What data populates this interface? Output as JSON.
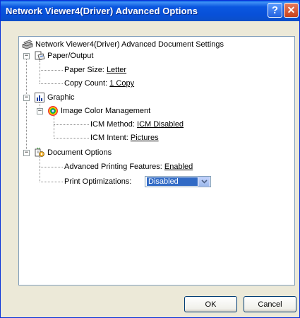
{
  "window": {
    "title": "Network Viewer4(Driver) Advanced Options"
  },
  "titlebar_buttons": {
    "help": "?",
    "close": "✕"
  },
  "tree": {
    "root_label": "Network Viewer4(Driver) Advanced Document Settings",
    "paper_output": {
      "label": "Paper/Output",
      "paper_size_label": "Paper Size:",
      "paper_size_value": "Letter",
      "copy_count_label": "Copy Count:",
      "copy_count_value": "1 Copy"
    },
    "graphic": {
      "label": "Graphic",
      "icm": {
        "label": "Image Color Management",
        "method_label": "ICM Method:",
        "method_value": "ICM Disabled",
        "intent_label": "ICM Intent:",
        "intent_value": "Pictures"
      }
    },
    "document_options": {
      "label": "Document Options",
      "advanced_printing_label": "Advanced Printing Features:",
      "advanced_printing_value": "Enabled",
      "print_optimizations_label": "Print Optimizations:",
      "print_optimizations_value": "Disabled"
    }
  },
  "buttons": {
    "ok": "OK",
    "cancel": "Cancel"
  },
  "colors": {
    "titlebar": "#0a57e0",
    "dialog_bg": "#ece9d8",
    "selection": "#316ac5",
    "close": "#c9411b"
  }
}
